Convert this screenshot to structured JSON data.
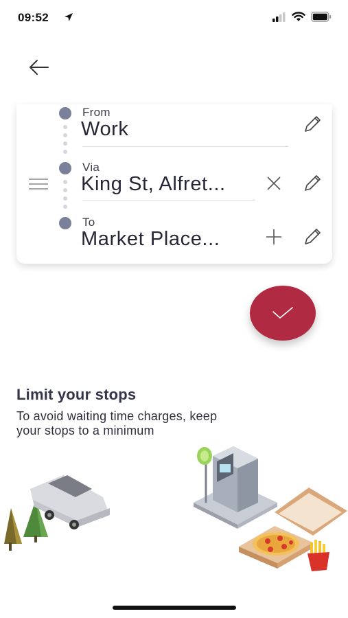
{
  "status_bar": {
    "time": "09:52"
  },
  "route": {
    "from": {
      "label": "From",
      "value": "Work"
    },
    "via": {
      "label": "Via",
      "value": "King St, Alfret..."
    },
    "to": {
      "label": "To",
      "value": "Market Place..."
    }
  },
  "tip": {
    "title": "Limit your stops",
    "body": "To avoid waiting time charges, keep your stops to a minimum"
  },
  "colors": {
    "accent": "#b02b42",
    "dot": "#7b809a",
    "text_dark": "#33334a"
  },
  "icons": [
    "back-arrow-icon",
    "pencil-icon",
    "close-icon",
    "plus-icon",
    "drag-handle-icon",
    "checkmark-icon"
  ]
}
